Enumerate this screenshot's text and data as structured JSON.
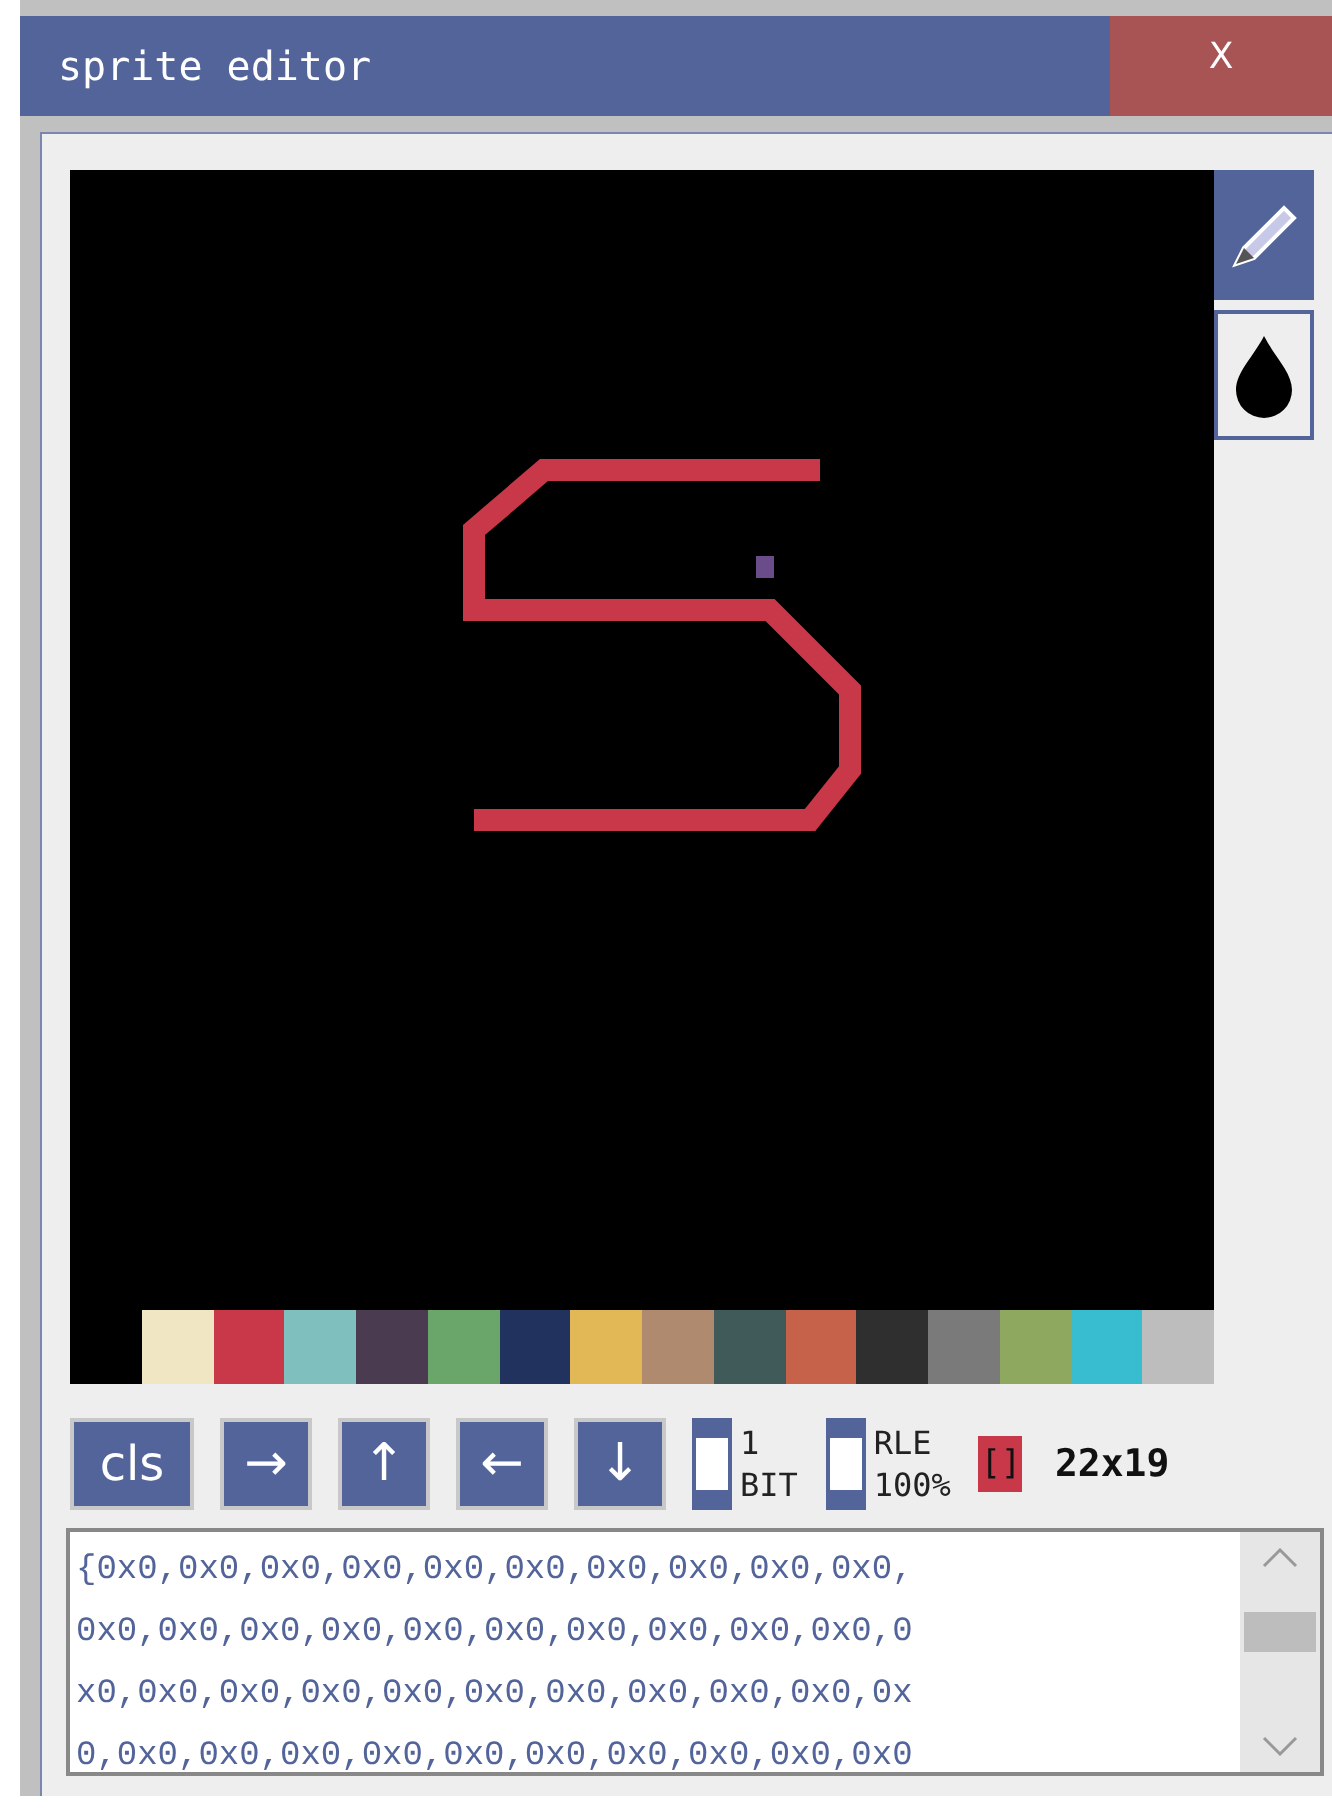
{
  "window": {
    "title": "sprite editor",
    "close_label": "X"
  },
  "tools": [
    {
      "kind": "pencil",
      "selected": true
    },
    {
      "kind": "fill",
      "selected": false
    }
  ],
  "palette": [
    {
      "color": "#f1e6c4"
    },
    {
      "color": "#c83848"
    },
    {
      "color": "#7fbfbd"
    },
    {
      "color": "#4a3b50"
    },
    {
      "color": "#6aa56a"
    },
    {
      "color": "#22325e"
    },
    {
      "color": "#e2b856"
    },
    {
      "color": "#b08a6e"
    },
    {
      "color": "#3f5a58"
    },
    {
      "color": "#c6624a"
    },
    {
      "color": "#2f2f2f"
    },
    {
      "color": "#7a7a7a"
    },
    {
      "color": "#8ea860"
    },
    {
      "color": "#38bcd0"
    },
    {
      "color": "#bdbdbd"
    }
  ],
  "buttons": [
    "cls",
    "→",
    "↑",
    "←",
    "↓"
  ],
  "toggles": [
    {
      "lines": [
        "1",
        "BIT"
      ],
      "checked": false
    },
    {
      "lines": [
        "RLE",
        "100%"
      ],
      "checked": false
    }
  ],
  "current_color": {
    "label": "[]",
    "color": "#c83848"
  },
  "size": "22x19",
  "output": [
    "{0x0,0x0,0x0,0x0,0x0,0x0,0x0,0x0,0x0,0x0,",
    "0x0,0x0,0x0,0x0,0x0,0x0,0x0,0x0,0x0,0x0,0",
    "x0,0x0,0x0,0x0,0x0,0x0,0x0,0x0,0x0,0x0,0x",
    "0,0x0,0x0,0x0,0x0,0x0,0x0,0x0,0x0,0x0,0x0"
  ]
}
